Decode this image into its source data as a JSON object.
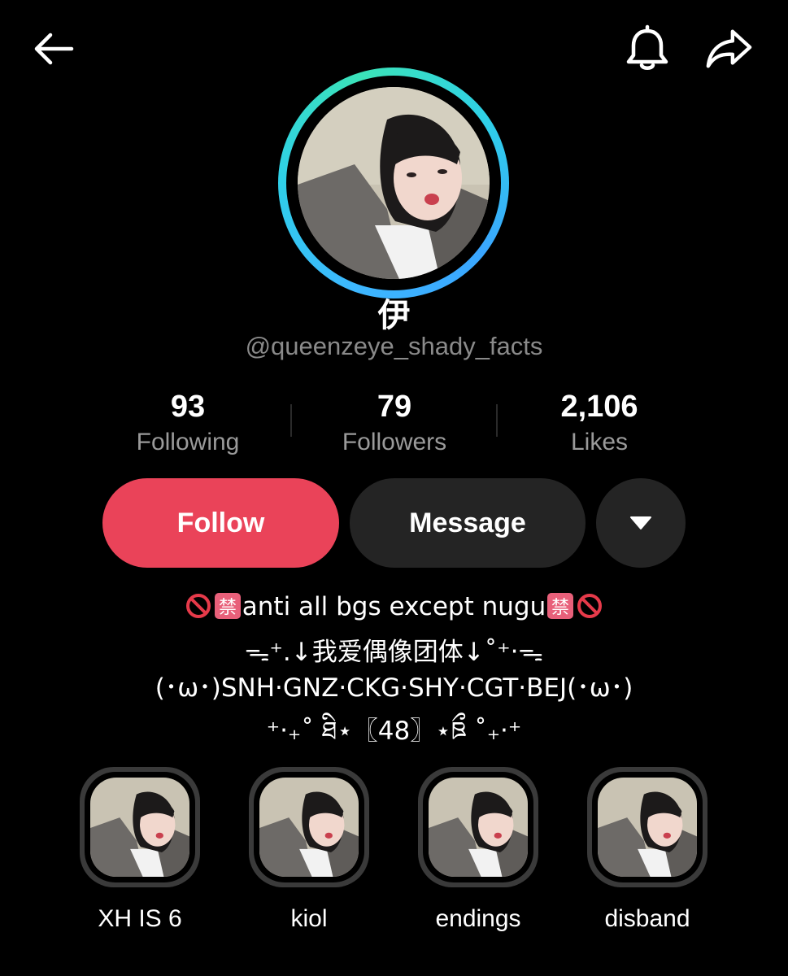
{
  "profile": {
    "display_name": "伊",
    "handle": "@queenzeye_shady_facts"
  },
  "stats": [
    {
      "value": "93",
      "label": "Following"
    },
    {
      "value": "79",
      "label": "Followers"
    },
    {
      "value": "2,106",
      "label": "Likes"
    }
  ],
  "actions": {
    "follow_label": "Follow",
    "message_label": "Message"
  },
  "bio": {
    "line1": "anti all bgs except nugu",
    "line2": "ᯓ⁺.↓我爱偶像团体↓˚⁺‧ᯓ",
    "line3": "(･ω･)SNH·GNZ·CKG·SHY·CGT·BEJ(･ω･)",
    "line4": "⁺‧₊˚ ཐི⋆〖48〗⋆ཋྀ ˚₊‧⁺"
  },
  "highlights": [
    {
      "label": "XH IS 6"
    },
    {
      "label": "kiol"
    },
    {
      "label": "endings"
    },
    {
      "label": "disband"
    }
  ],
  "colors": {
    "follow": "#ea4359",
    "secondary_button": "#242424",
    "ring_start": "#3db7ff",
    "ring_end": "#3be3b8"
  },
  "icons": [
    "back-arrow-icon",
    "bell-icon",
    "share-icon",
    "caret-down-icon",
    "no-entry-icon",
    "prohibited-kanji-icon"
  ]
}
